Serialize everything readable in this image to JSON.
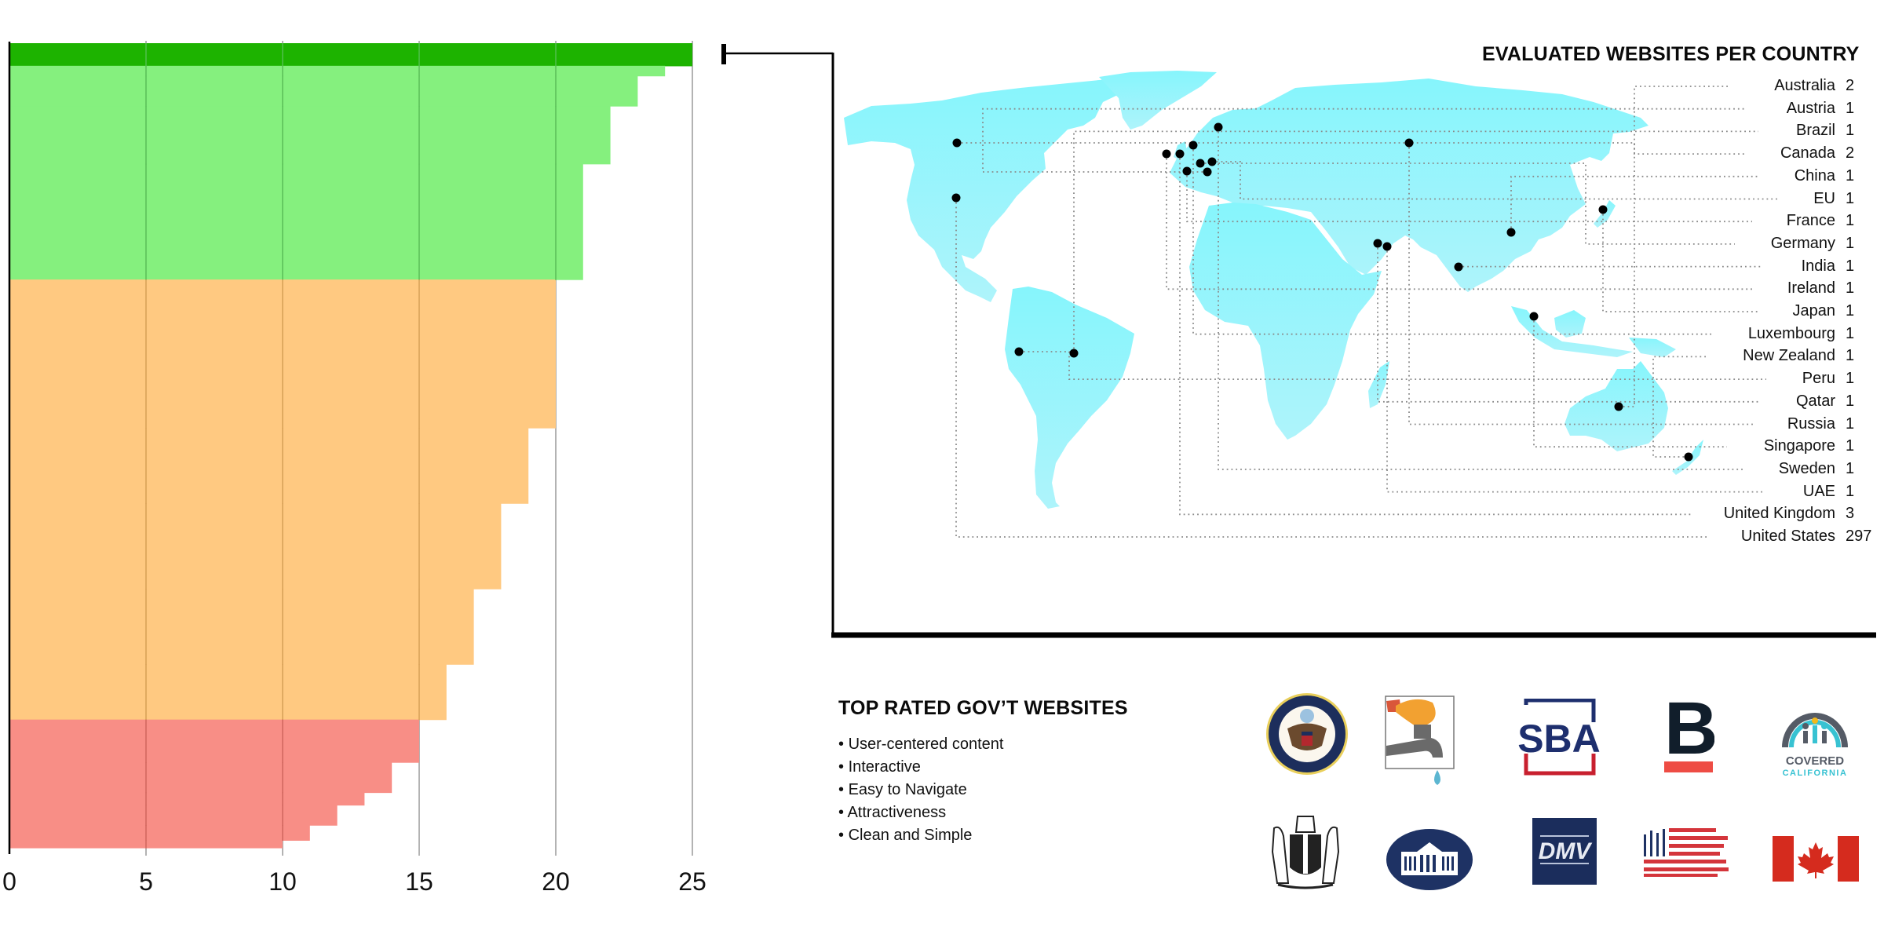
{
  "chart_data": [
    {
      "type": "bar",
      "orientation": "horizontal-step",
      "title": "",
      "xlabel": "",
      "ylabel": "",
      "xlim": [
        0,
        25
      ],
      "x_ticks": [
        "0",
        "5",
        "10",
        "15",
        "20",
        "25"
      ],
      "grid": true,
      "description": "Stacked rows of websites sorted by score; each step is a score value with width = score and height proportional to number of websites at that score",
      "bands": [
        {
          "name": "top",
          "color": "#1DB300"
        },
        {
          "name": "good",
          "color": "#85F07E"
        },
        {
          "name": "average",
          "color": "#FFC981"
        },
        {
          "name": "poor",
          "color": "#F88E86"
        }
      ],
      "steps": [
        {
          "score": 25,
          "count": 9,
          "band": "top"
        },
        {
          "score": 24,
          "count": 4,
          "band": "good"
        },
        {
          "score": 23,
          "count": 12,
          "band": "good"
        },
        {
          "score": 22,
          "count": 23,
          "band": "good"
        },
        {
          "score": 21,
          "count": 46,
          "band": "good"
        },
        {
          "score": 20,
          "count": 59,
          "band": "average"
        },
        {
          "score": 19,
          "count": 30,
          "band": "average"
        },
        {
          "score": 18,
          "count": 34,
          "band": "average"
        },
        {
          "score": 17,
          "count": 30,
          "band": "average"
        },
        {
          "score": 16,
          "count": 22,
          "band": "average"
        },
        {
          "score": 15,
          "count": 17,
          "band": "poor"
        },
        {
          "score": 14,
          "count": 12,
          "band": "poor"
        },
        {
          "score": 13,
          "count": 5,
          "band": "poor"
        },
        {
          "score": 12,
          "count": 8,
          "band": "poor"
        },
        {
          "score": 11,
          "count": 6,
          "band": "poor"
        },
        {
          "score": 10,
          "count": 3,
          "band": "poor"
        }
      ]
    },
    {
      "type": "table",
      "title": "EVALUATED WEBSITES PER COUNTRY",
      "map_color_top": "#86F5FC",
      "map_color_bottom": "#AEF4FB",
      "rows": [
        {
          "country": "Australia",
          "count": "2"
        },
        {
          "country": "Austria",
          "count": "1"
        },
        {
          "country": "Brazil",
          "count": "1"
        },
        {
          "country": "Canada",
          "count": "2"
        },
        {
          "country": "China",
          "count": "1"
        },
        {
          "country": "EU",
          "count": "1"
        },
        {
          "country": "France",
          "count": "1"
        },
        {
          "country": "Germany",
          "count": "1"
        },
        {
          "country": "India",
          "count": "1"
        },
        {
          "country": "Ireland",
          "count": "1"
        },
        {
          "country": "Japan",
          "count": "1"
        },
        {
          "country": "Luxembourg",
          "count": "1"
        },
        {
          "country": "New Zealand",
          "count": "1"
        },
        {
          "country": "Peru",
          "count": "1"
        },
        {
          "country": "Qatar",
          "count": "1"
        },
        {
          "country": "Russia",
          "count": "1"
        },
        {
          "country": "Singapore",
          "count": "1"
        },
        {
          "country": "Sweden",
          "count": "1"
        },
        {
          "country": "UAE",
          "count": "1"
        },
        {
          "country": "United Kingdom",
          "count": "3"
        },
        {
          "country": "United States",
          "count": "297"
        }
      ]
    }
  ],
  "top_rated": {
    "title": "TOP RATED GOV’T WEBSITES",
    "criteria": [
      "User-centered content",
      "Interactive",
      "Easy to Navigate",
      "Attractiveness",
      "Clean and Simple"
    ],
    "logos": [
      {
        "name": "us-department-of-state-seal"
      },
      {
        "name": "water-tap-logo"
      },
      {
        "name": "sba-logo",
        "text": "SBA"
      },
      {
        "name": "b-logo",
        "text": "B"
      },
      {
        "name": "covered-california-logo",
        "text1": "COVERED",
        "text2": "CALIFORNIA"
      },
      {
        "name": "new-zealand-coat-of-arms"
      },
      {
        "name": "white-house-logo"
      },
      {
        "name": "dmv-logo",
        "text": "DMV"
      },
      {
        "name": "usa-flag-bars-logo"
      },
      {
        "name": "canada-flag"
      }
    ]
  }
}
